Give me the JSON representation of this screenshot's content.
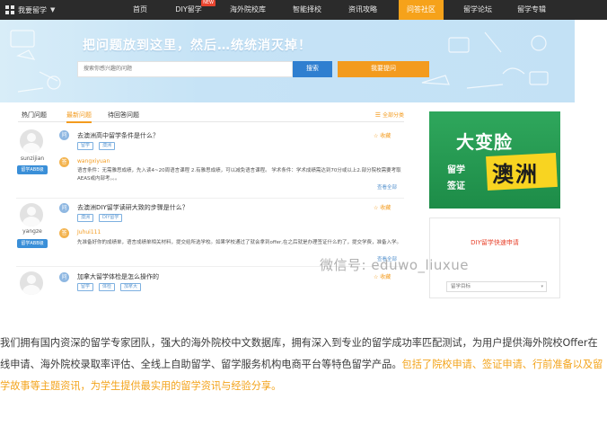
{
  "nav": {
    "menu_label": "我要留学",
    "items": [
      {
        "label": "首页"
      },
      {
        "label": "DIY留学",
        "badge": "NEW"
      },
      {
        "label": "海外院校库"
      },
      {
        "label": "智能择校"
      },
      {
        "label": "资讯攻略"
      },
      {
        "label": "问答社区",
        "active": true
      },
      {
        "label": "留学论坛"
      },
      {
        "label": "留学专辑"
      }
    ]
  },
  "banner": {
    "headline": "把问题放到这里，然后…统统消灭掉！",
    "search_placeholder": "搜索你感兴趣的问题",
    "search_button": "搜索",
    "ask_button": "我要提问"
  },
  "tabs": {
    "items": [
      "热门问题",
      "最新问题",
      "待回答问题"
    ],
    "all_link": "全部分类"
  },
  "questions": [
    {
      "user": "sunzijian",
      "user_badge": "留学ABB级",
      "title": "去澳洲高中留学条件是什么？",
      "favorite": "收藏",
      "tags": [
        "留学",
        "澳洲"
      ],
      "answerer": "wangxiyuan",
      "answer": "语言条件：无需雅思成绩，先入读4~20周语言课程 2.有雅思成绩，可以减免语言课程。 学术条件：学术成绩需达到70分或以上2.部分院校需要考取AEAS或内部考。。。",
      "view_all": "查看全部"
    },
    {
      "user": "yangze",
      "user_badge": "留学ABB级",
      "title": "去澳洲DIY留学读研大致的步骤是什么？",
      "favorite": "收藏",
      "tags": [
        "澳洲",
        "DIY留学"
      ],
      "answerer": "Juhui111",
      "answer": "先准备好你的成绩单，语言成绩单相关材料，提交给所选学校。如果学校通过了就会拿到offer,在之后就是办理签证什么的了，提交学费，准备入学。",
      "view_all": "查看全部"
    },
    {
      "user": "",
      "user_badge": "",
      "title": "加拿大留学体检是怎么操作的",
      "favorite": "收藏",
      "tags": [
        "留学",
        "体检",
        "加拿大"
      ]
    }
  ],
  "ad": {
    "title": "大变脸",
    "line1": "留学",
    "line2": "签证",
    "stamp": "澳洲"
  },
  "quick_apply": {
    "title": "DIY留学快速申请",
    "field_label": "留学目标"
  },
  "watermark": "微信号: eduwo_liuxue",
  "description": {
    "normal": "我们拥有国内资深的留学专家团队，强大的海外院校中文数据库，拥有深入到专业的留学成功率匹配测试，为用户提供海外院校Offer在线申请、海外院校录取率评估、全线上自助留学、留学服务机构电商平台等特色留学产品。",
    "highlight": "包括了院校申请、签证申请、行前准备以及留学故事等主题资讯，为学生提供最实用的留学资讯与经验分享。"
  },
  "colors": {
    "nav_bg": "#2b2b2b",
    "accent_orange": "#f39b1e",
    "accent_blue": "#2f7fd0",
    "ad_green": "#1d8c48",
    "stamp_yellow": "#f8d421"
  }
}
